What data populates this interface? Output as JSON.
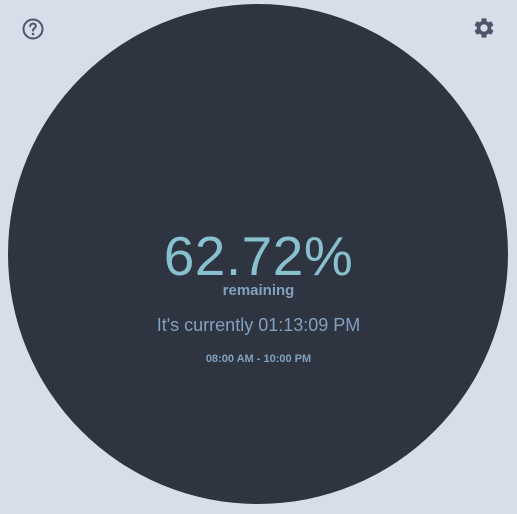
{
  "toolbar": {
    "help_icon": "help-circle-icon",
    "settings_icon": "gear-icon"
  },
  "dial": {
    "percent_text": "62.72%",
    "remaining_label": "remaining",
    "current_time_text": "It's currently 01:13:09 PM",
    "range_text": "08:00 AM - 10:00 PM"
  },
  "colors": {
    "background": "#d8dee9",
    "dial": "#2e3440",
    "accent": "#88c0d0",
    "secondary": "#81a1c1",
    "icon": "#4c566a"
  }
}
